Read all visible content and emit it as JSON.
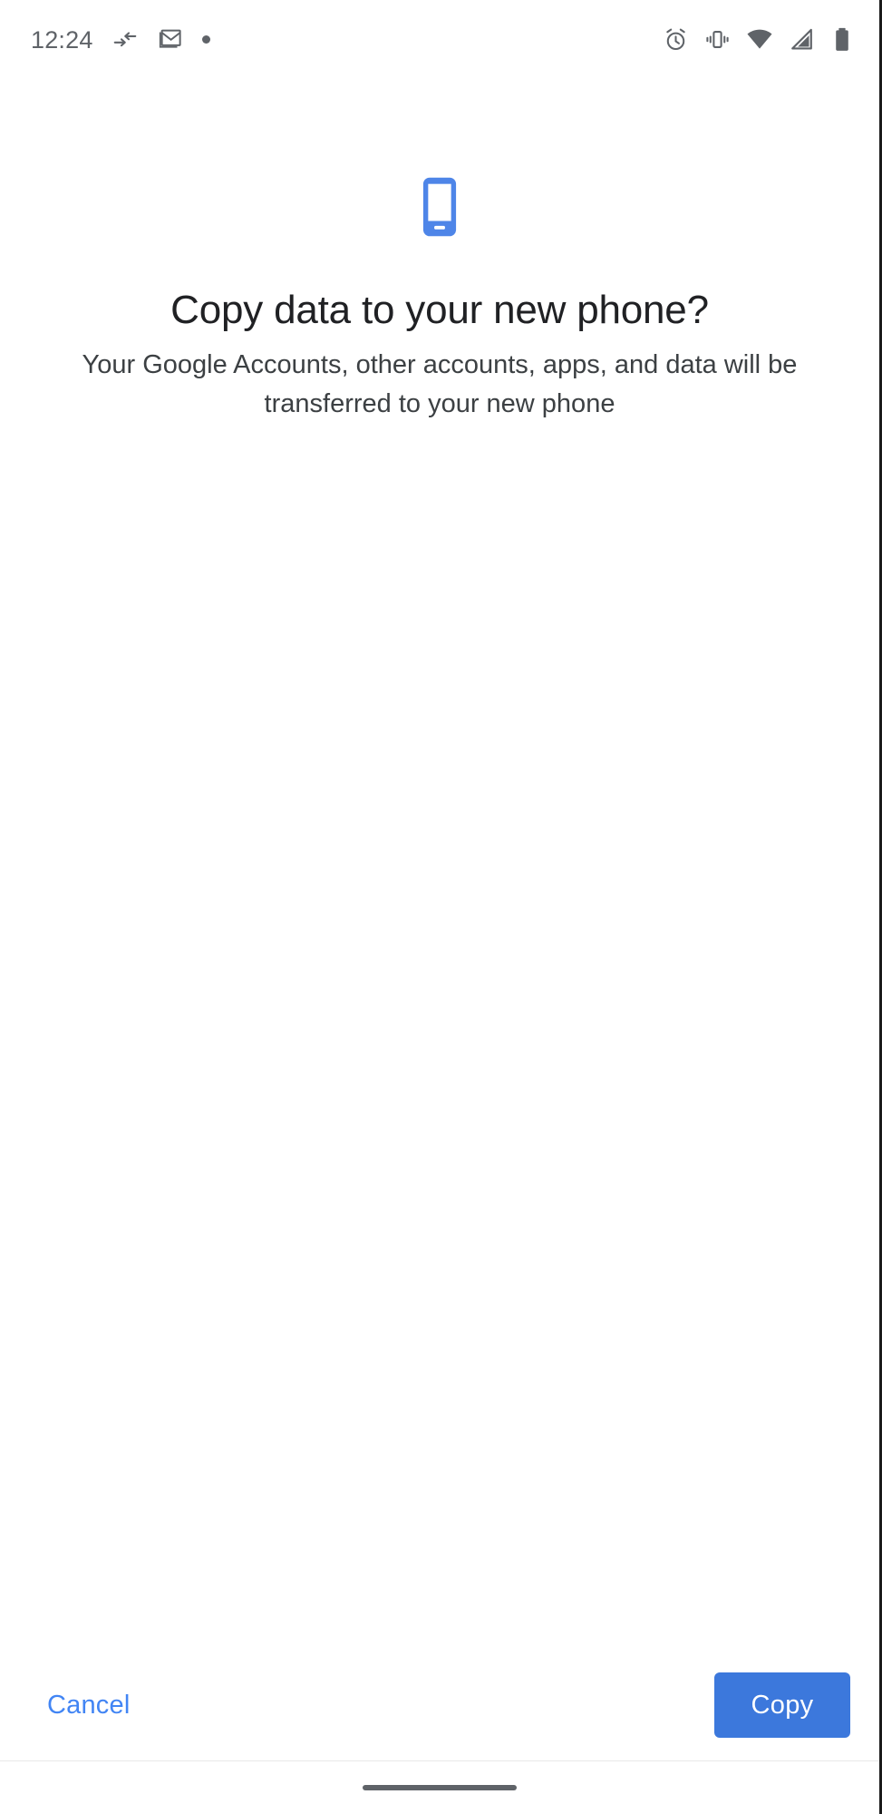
{
  "status_bar": {
    "time": "12:24",
    "left_icons": [
      {
        "name": "data-transfer-icon",
        "label": "data transfer"
      },
      {
        "name": "gmail-icon",
        "label": "Gmail"
      },
      {
        "name": "notification-dot-icon",
        "label": "notification"
      }
    ],
    "right_icons": [
      {
        "name": "alarm-clock-icon",
        "label": "alarm set"
      },
      {
        "name": "vibrate-icon",
        "label": "vibrate mode"
      },
      {
        "name": "wifi-icon",
        "label": "wifi"
      },
      {
        "name": "cellular-signal-icon",
        "label": "cellular signal"
      },
      {
        "name": "battery-icon",
        "label": "battery full"
      }
    ]
  },
  "main": {
    "hero_icon": "smartphone-icon",
    "title": "Copy data to your new phone?",
    "subtitle": "Your Google Accounts, other accounts, apps, and data will be transferred to your new phone"
  },
  "actions": {
    "cancel_label": "Cancel",
    "copy_label": "Copy"
  },
  "nav_bar": {
    "home_indicator": "home-gesture-pill"
  },
  "colors": {
    "accent_blue": "#4285f4",
    "button_blue": "#3c78dc",
    "title_text": "#202124",
    "body_text": "#3c4043",
    "status_icon": "#5f6368",
    "background": "#ffffff",
    "divider": "#e8e8e8"
  }
}
